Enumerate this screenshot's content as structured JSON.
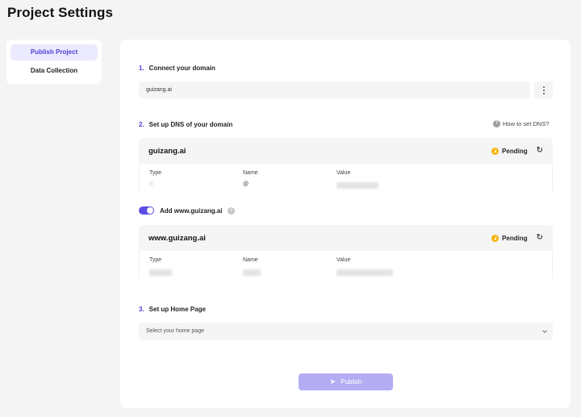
{
  "page": {
    "title": "Project Settings"
  },
  "sidebar": {
    "items": [
      {
        "label": "Publish Project",
        "active": true
      },
      {
        "label": "Data Collection",
        "active": false
      }
    ]
  },
  "steps": {
    "connect": {
      "num": "1.",
      "label": "Connect your domain",
      "domain_value": "guizang.ai"
    },
    "dns": {
      "num": "2.",
      "label": "Set up DNS of your domain",
      "help_label": "How to set DNS?"
    },
    "home": {
      "num": "3.",
      "label": "Set up Home Page",
      "placeholder": "Select your home page"
    }
  },
  "dns_records": [
    {
      "domain": "guizang.ai",
      "status": "Pending",
      "col_type": "Type",
      "col_name": "Name",
      "col_value": "Value",
      "type_value": "A",
      "name_value": "@"
    },
    {
      "domain": "www.guizang.ai",
      "status": "Pending",
      "col_type": "Type",
      "col_name": "Name",
      "col_value": "Value"
    }
  ],
  "www_toggle": {
    "label": "Add www.guizang.ai",
    "on": true
  },
  "publish": {
    "label": "Publish"
  },
  "colors": {
    "accent": "#5b4de6",
    "pending": "#f5b50b",
    "publish_disabled": "#b4adf4"
  },
  "icons": {
    "more": "more-vertical-icon",
    "help": "question-icon",
    "status": "clock-icon",
    "refresh": "refresh-icon",
    "info": "info-icon",
    "chevron": "chevron-down-icon",
    "publish": "paper-plane-icon"
  }
}
